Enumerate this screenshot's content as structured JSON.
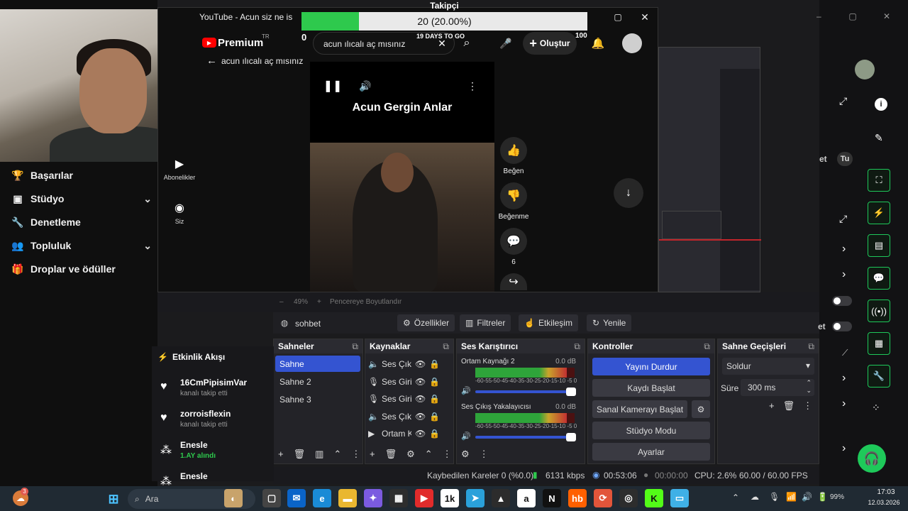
{
  "left_nav": {
    "items": [
      {
        "label": "Başarılar",
        "icon": "trophy-icon",
        "chevron": false
      },
      {
        "label": "Stüdyo",
        "icon": "studio-icon",
        "chevron": true
      },
      {
        "label": "Denetleme",
        "icon": "wrench-icon",
        "chevron": false
      },
      {
        "label": "Topluluk",
        "icon": "people-icon",
        "chevron": true
      },
      {
        "label": "Droplar ve ödüller",
        "icon": "gift-icon",
        "chevron": false
      }
    ]
  },
  "yt_window": {
    "title": "YouTube - Acun siz ne is",
    "logo_text": "Premium",
    "logo_region": "TR",
    "search_value": "acun ılıcalı aç mısınız",
    "back_query": "acun ılıcalı aç mısınız",
    "create_label": "Oluştur",
    "side_items": [
      {
        "label": "Abonelikler",
        "icon": "subscriptions-icon"
      },
      {
        "label": "Siz",
        "icon": "account-icon"
      }
    ],
    "video_caption": "Acun Gergin Anlar",
    "like_label": "Beğen",
    "dislike_label": "Beğenme",
    "comment_count": "6"
  },
  "goal": {
    "title": "Takipçi",
    "text": "20 (20.00%)",
    "progress": 0.2,
    "min": "0",
    "max": "100",
    "deadline": "19 DAYS TO GO"
  },
  "obs": {
    "zoom": "49%",
    "fit_label": "Pencereye Boyutlandır",
    "source_name": "sohbet",
    "toolbar": [
      "Özellikler",
      "Filtreler",
      "Etkileşim",
      "Yenile"
    ],
    "scenes_title": "Sahneler",
    "scenes": [
      "Sahne",
      "Sahne 2",
      "Sahne 3"
    ],
    "sources_title": "Kaynaklar",
    "sources": [
      {
        "label": "Ses Çıkı",
        "icon": "speaker-icon"
      },
      {
        "label": "Ses Giri:",
        "icon": "mic-icon"
      },
      {
        "label": "Ses Giri:",
        "icon": "mic-icon"
      },
      {
        "label": "Ses Çıkı",
        "icon": "speaker-icon"
      },
      {
        "label": "Ortam K",
        "icon": "play-icon"
      }
    ],
    "mixer_title": "Ses Karıştırıcı",
    "mixer": [
      {
        "name": "Ortam Kaynağı 2",
        "db": "0.0 dB",
        "level": 0.92
      },
      {
        "name": "Ses Çıkış Yakalayıcısı",
        "db": "0.0 dB",
        "level": 0.92
      }
    ],
    "meter_scale": "-60-55-50-45-40-35-30-25-20-15-10 -5 0",
    "controls_title": "Kontroller",
    "controls": [
      "Yayını Durdur",
      "Kaydı Başlat",
      "Sanal Kamerayı Başlat",
      "Stüdyo Modu",
      "Ayarlar"
    ],
    "transitions_title": "Sahne Geçişleri",
    "transition_value": "Soldur",
    "duration_label": "Süre",
    "duration_value": "300 ms",
    "status": {
      "dropped": "Kaybedilen Kareler 0 (%0.0)",
      "bitrate": "6131 kbps",
      "stream_time": "00:53:06",
      "rec_time": "00:00:00",
      "cpu": "CPU: 2.6%",
      "fps": "60.00 / 60.00 FPS"
    }
  },
  "feed": {
    "title": "Etkinlik Akışı",
    "items": [
      {
        "name": "16CmPipisimVar",
        "sub": "kanalı takip etti",
        "icon": "heart-icon",
        "highlight": false
      },
      {
        "name": "zorroisflexin",
        "sub": "kanalı takip etti",
        "icon": "heart-icon",
        "highlight": false
      },
      {
        "name": "Enesle",
        "sub": "1.AY alındı",
        "icon": "sub-icon",
        "highlight": true
      },
      {
        "name": "Enesle",
        "sub": "",
        "icon": "sub-icon",
        "highlight": false
      }
    ]
  },
  "right_side": {
    "chips": [
      "et",
      "Tu",
      "et"
    ]
  },
  "taskbar": {
    "search_label": "Ara",
    "badge": "3",
    "battery": "99%",
    "time": "17:03",
    "date": "12.03.2026"
  }
}
